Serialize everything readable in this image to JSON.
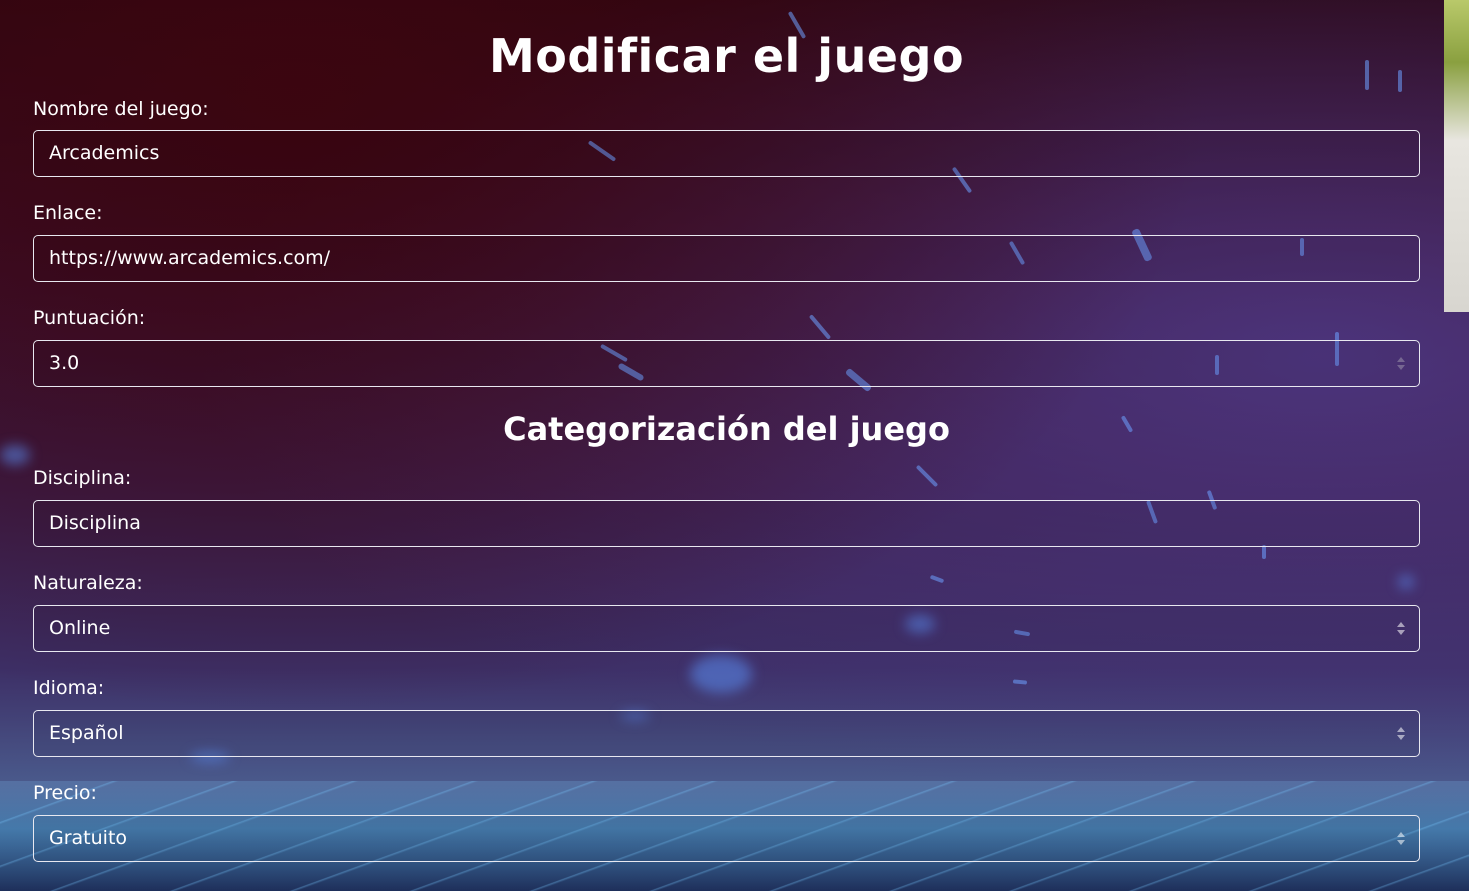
{
  "page": {
    "title": "Modificar el juego",
    "section_title": "Categorización del juego"
  },
  "fields": {
    "nombre": {
      "label": "Nombre del juego:",
      "value": "Arcademics"
    },
    "enlace": {
      "label": "Enlace:",
      "value": "https://www.arcademics.com/"
    },
    "puntuacion": {
      "label": "Puntuación:",
      "value": "3.0"
    },
    "disciplina": {
      "label": "Disciplina:",
      "value": "Disciplina"
    },
    "naturaleza": {
      "label": "Naturaleza:",
      "value": "Online"
    },
    "idioma": {
      "label": "Idioma:",
      "value": "Español"
    },
    "precio": {
      "label": "Precio:",
      "value": "Gratuito"
    }
  },
  "icons": {
    "select_arrow": "chevron-updown-icon",
    "number_spinner": "spinner-icon"
  },
  "colors": {
    "text": "#ffffff",
    "input_border": "#e8e8f0"
  }
}
